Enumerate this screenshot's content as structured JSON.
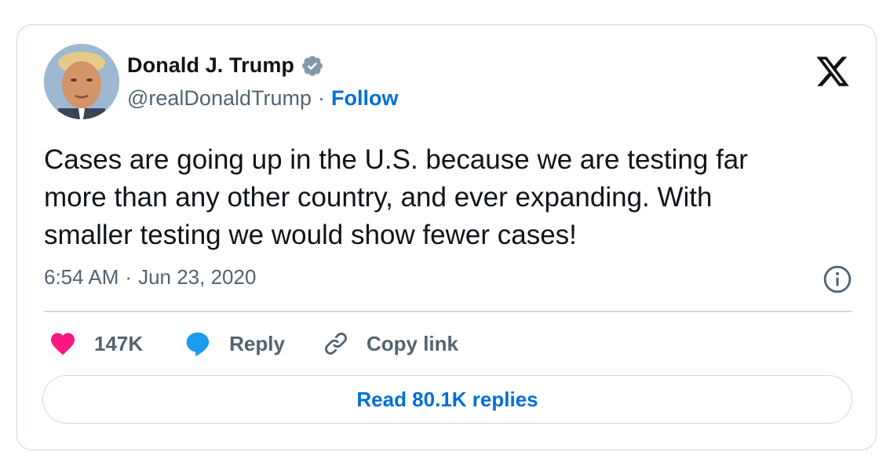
{
  "author": {
    "display_name": "Donald J. Trump",
    "handle": "@realDonaldTrump",
    "separator": "·",
    "follow_label": "Follow"
  },
  "tweet": {
    "text": "Cases are going up in the U.S. because we are testing far\nmore than any other country, and ever expanding. With\nsmaller testing we would show fewer cases!",
    "time": "6:54 AM",
    "date_separator": "·",
    "date": "Jun 23, 2020"
  },
  "actions": {
    "likes_count": "147K",
    "reply_label": "Reply",
    "copy_link_label": "Copy link"
  },
  "footer": {
    "read_replies_label": "Read 80.1K replies"
  },
  "colors": {
    "link_blue": "#006fd6",
    "like_pink": "#f91880",
    "reply_blue": "#1d9bf0",
    "muted_gray": "#536471",
    "border": "#cfd9de",
    "verified_gray": "#829aab"
  },
  "icons": {
    "brand": "x-logo-icon",
    "verified": "verified-badge-icon",
    "info": "info-icon",
    "like": "heart-icon",
    "reply": "speech-bubble-icon",
    "copy": "link-icon"
  }
}
